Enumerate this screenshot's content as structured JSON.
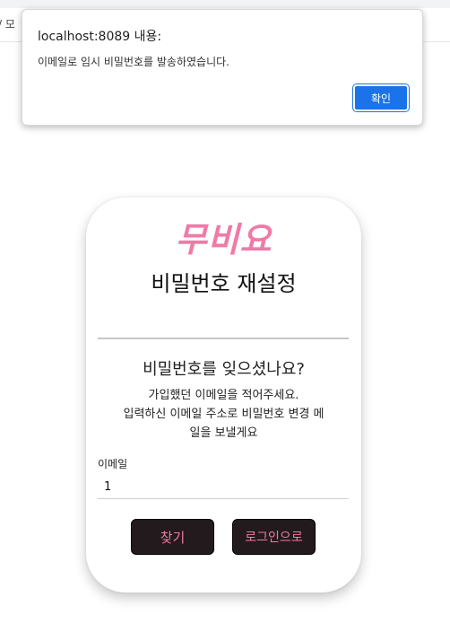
{
  "browser": {
    "bookmark_text": "/ 모"
  },
  "alert": {
    "title": "localhost:8089 내용:",
    "message": "이메일로 임시 비밀번호를 발송하였습니다.",
    "ok_label": "확인",
    "accent_color": "#1a73e8"
  },
  "card": {
    "brand": "무비요",
    "title": "비밀번호 재설정",
    "question": "비밀번호를 잊으셨나요?",
    "instruction_lines": [
      "가입했던 이메일을 적어주세요.",
      "입력하신 이메일 주소로 비밀번호 변경 메",
      "일을 보낼게요"
    ],
    "email_label": "이메일",
    "email_value": "1",
    "find_label": "찾기",
    "login_label": "로그인으로",
    "brand_color": "#f07aa8",
    "button_bg_color": "#221a1c"
  }
}
